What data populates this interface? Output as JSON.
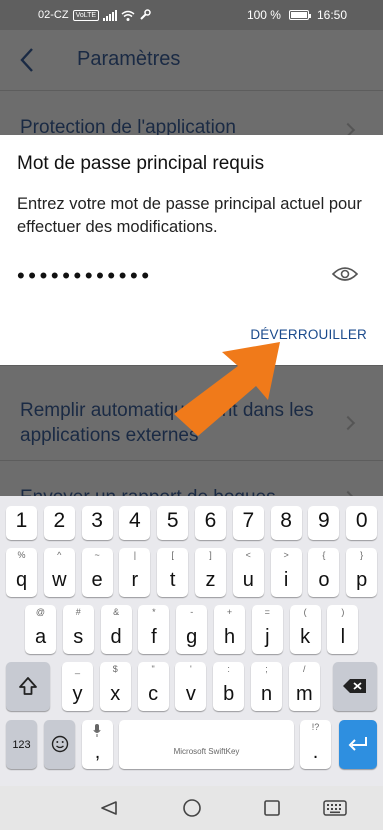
{
  "status_bar": {
    "carrier": "02-CZ",
    "network_badge": "VoLTE",
    "battery": "100 %",
    "time": "16:50",
    "icons": [
      "signal-icon",
      "wifi-icon",
      "wrench-icon",
      "battery-icon"
    ]
  },
  "header": {
    "title": "Paramètres",
    "back_icon": "chevron-left-icon"
  },
  "settings_rows": [
    {
      "label": "Protection de l'application"
    },
    {
      "label": "Remplir automatiquement dans les applications externes"
    },
    {
      "label": "Envoyer un rapport de bogues"
    }
  ],
  "dialog": {
    "title": "Mot de passe principal requis",
    "message": "Entrez votre mot de passe principal actuel pour effectuer des modifications.",
    "password_mask": "••••••••••••",
    "eye_icon": "eye-icon",
    "unlock_label": "DÉVERROUILLER"
  },
  "overlay": {
    "arrow_color": "#f07a1a"
  },
  "keyboard": {
    "brand": "Microsoft SwiftKey",
    "number_row": [
      "1",
      "2",
      "3",
      "4",
      "5",
      "6",
      "7",
      "8",
      "9",
      "0"
    ],
    "row1": [
      {
        "main": "q",
        "alt": "%"
      },
      {
        "main": "w",
        "alt": "^"
      },
      {
        "main": "e",
        "alt": "~"
      },
      {
        "main": "r",
        "alt": "|"
      },
      {
        "main": "t",
        "alt": "["
      },
      {
        "main": "z",
        "alt": "]"
      },
      {
        "main": "u",
        "alt": "<"
      },
      {
        "main": "i",
        "alt": ">"
      },
      {
        "main": "o",
        "alt": "{"
      },
      {
        "main": "p",
        "alt": "}"
      }
    ],
    "row2": [
      {
        "main": "a",
        "alt": "@"
      },
      {
        "main": "s",
        "alt": "#"
      },
      {
        "main": "d",
        "alt": "&"
      },
      {
        "main": "f",
        "alt": "*"
      },
      {
        "main": "g",
        "alt": "-"
      },
      {
        "main": "h",
        "alt": "+"
      },
      {
        "main": "j",
        "alt": "="
      },
      {
        "main": "k",
        "alt": "("
      },
      {
        "main": "l",
        "alt": ")"
      }
    ],
    "row3": [
      {
        "main": "y",
        "alt": "_"
      },
      {
        "main": "x",
        "alt": "$"
      },
      {
        "main": "c",
        "alt": "\""
      },
      {
        "main": "v",
        "alt": "'"
      },
      {
        "main": "b",
        "alt": ":"
      },
      {
        "main": "n",
        "alt": ";"
      },
      {
        "main": "m",
        "alt": "/"
      }
    ],
    "numbers_key": "123",
    "comma_key": ",",
    "period_key": ".",
    "period_alt": "!?"
  },
  "nav": {
    "icons": [
      "back-triangle-icon",
      "home-circle-icon",
      "recents-square-icon",
      "keyboard-icon"
    ]
  }
}
